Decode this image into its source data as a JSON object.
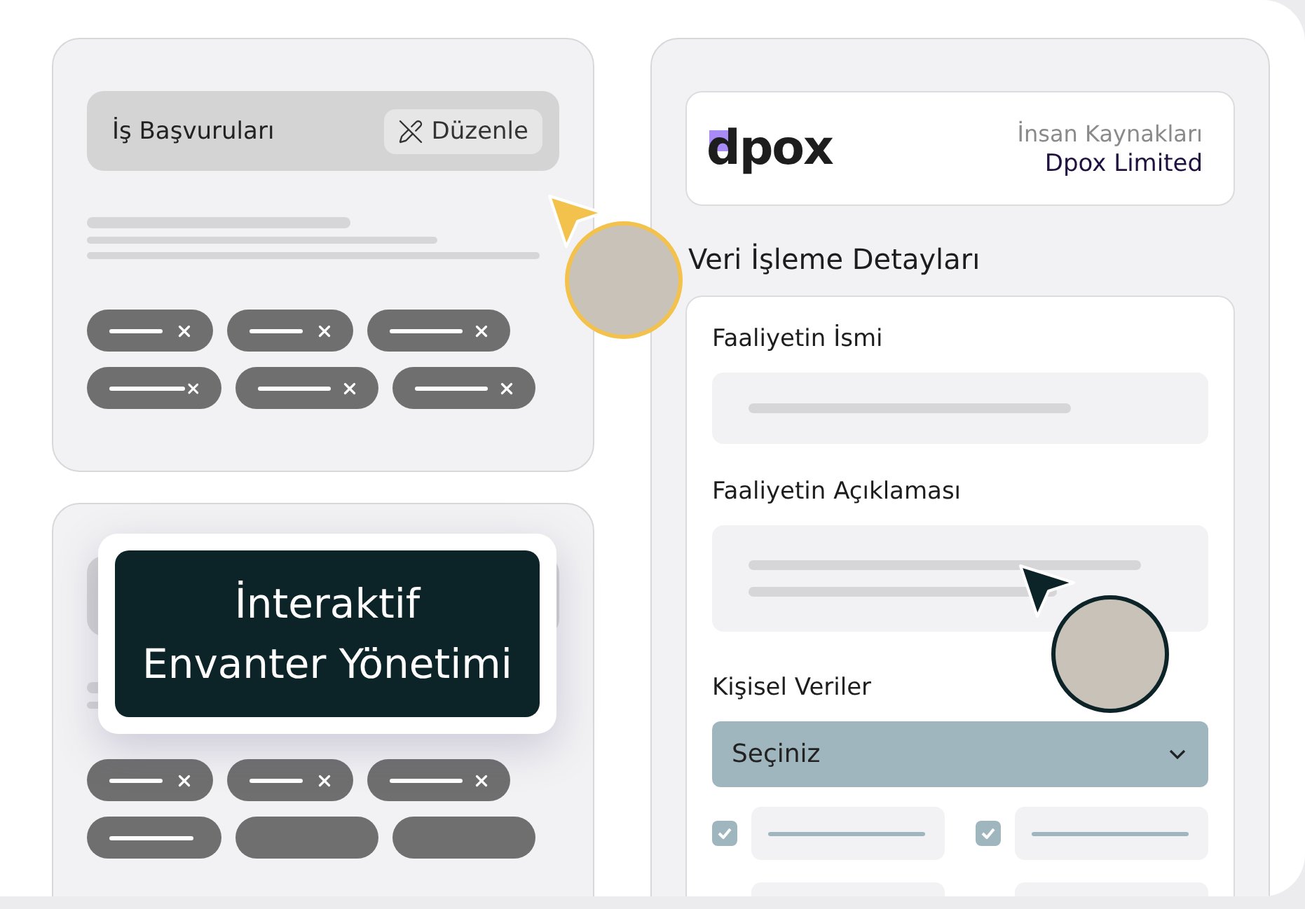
{
  "left_cards": [
    {
      "title": "İş Başvuruları",
      "button": "Düzenle",
      "tags": [
        {
          "removable": true
        },
        {
          "removable": true
        },
        {
          "removable": true
        },
        {
          "removable": true
        },
        {
          "removable": true
        },
        {
          "removable": true
        }
      ]
    },
    {
      "tags": [
        {
          "removable": true
        },
        {
          "removable": true
        },
        {
          "removable": true
        },
        {
          "removable": false
        },
        {
          "removable": false
        },
        {
          "removable": false
        }
      ]
    }
  ],
  "callout": {
    "lines": [
      "İnteraktif",
      "Envanter Yönetimi"
    ]
  },
  "panel": {
    "logo": "dpox",
    "department": "İnsan Kaynakları",
    "company": "Dpox Limited",
    "heading": "Veri İşleme Detayları",
    "fields": [
      {
        "label": "Faaliyetin İsmi",
        "kind": "single"
      },
      {
        "label": "Faaliyetin Açıklaması",
        "kind": "multi"
      }
    ],
    "select": {
      "label": "Kişisel Veriler",
      "value": "Seçiniz"
    },
    "options": [
      {
        "kind": "checkbox",
        "checked": true
      },
      {
        "kind": "checkbox",
        "checked": true
      },
      {
        "kind": "plain"
      },
      {
        "kind": "plain"
      }
    ]
  }
}
